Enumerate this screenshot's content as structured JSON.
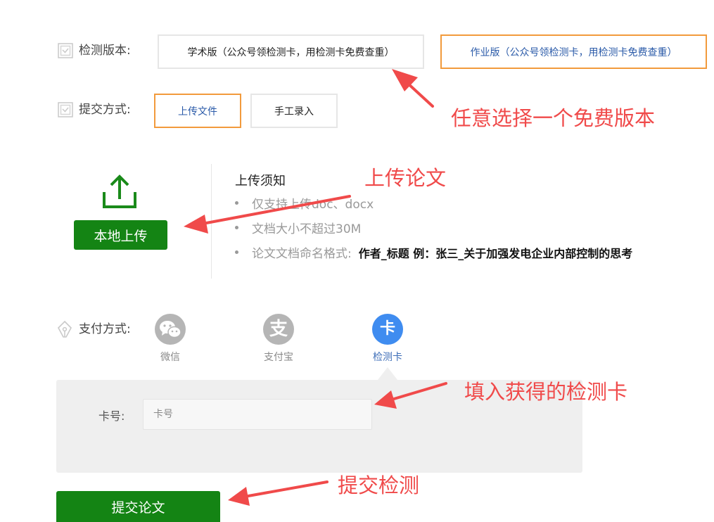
{
  "detection_version": {
    "label": "检测版本:",
    "options": [
      {
        "label": "学术版（公众号领检测卡，用检测卡免费查重）",
        "selected": false
      },
      {
        "label": "作业版（公众号领检测卡，用检测卡免费查重）",
        "selected": true
      }
    ]
  },
  "submit_method": {
    "label": "提交方式:",
    "options": [
      {
        "label": "上传文件",
        "selected": true
      },
      {
        "label": "手工录入",
        "selected": false
      }
    ]
  },
  "upload": {
    "button_label": "本地上传",
    "notice_title": "上传须知",
    "notice_items": [
      "仅支持上传doc、docx",
      "文档大小不超过30M",
      "论文文档命名格式:"
    ],
    "naming_example": "作者_标题 例：张三_关于加强发电企业内部控制的思考"
  },
  "payment": {
    "label": "支付方式:",
    "options": [
      {
        "label": "微信",
        "icon": "wechat-icon",
        "glyph": "",
        "active": false
      },
      {
        "label": "支付宝",
        "icon": "alipay-icon",
        "glyph": "支",
        "active": false
      },
      {
        "label": "检测卡",
        "icon": "card-icon",
        "glyph": "卡",
        "active": true
      }
    ],
    "card_label": "卡号:",
    "card_placeholder": "卡号",
    "card_value": ""
  },
  "submit_button_label": "提交论文",
  "annotations": {
    "choose_version": "任意选择一个免费版本",
    "upload_paper": "上传论文",
    "fill_card": "填入获得的检测卡",
    "submit_check": "提交检测"
  },
  "colors": {
    "accent_orange": "#f29a3c",
    "green": "#148414",
    "annotation_red": "#f04a4a",
    "selected_text_blue": "#2a5aa8",
    "card_blue": "#3f8cf0",
    "inactive_gray": "#b5b5b5"
  }
}
